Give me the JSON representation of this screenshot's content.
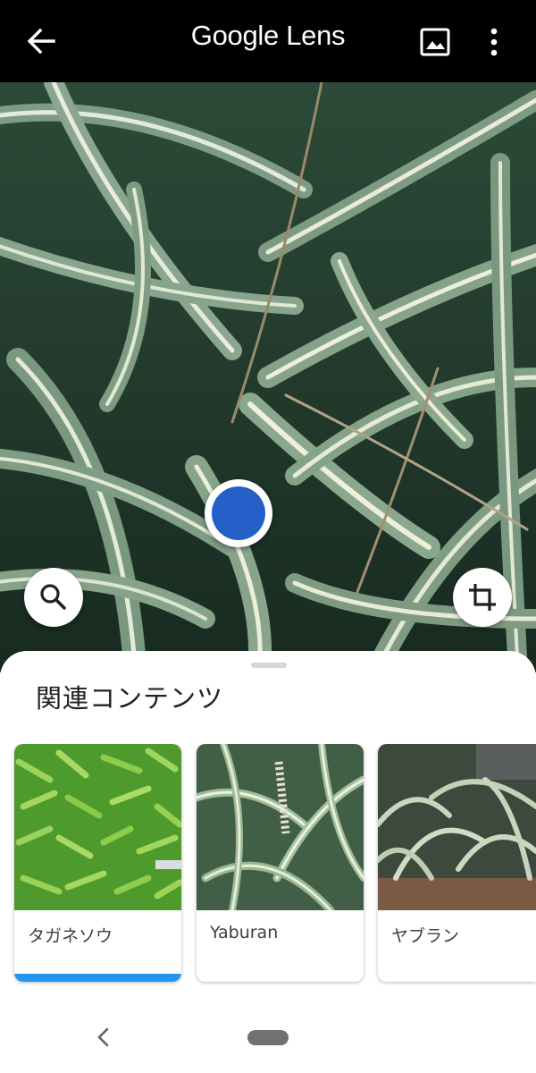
{
  "app": {
    "title": "Google Lens"
  },
  "toolbar": {
    "back_icon": "arrow-back-icon",
    "gallery_icon": "image-gallery-icon",
    "more_icon": "more-vert-icon"
  },
  "viewer": {
    "search_icon": "search-icon",
    "crop_icon": "crop-icon",
    "accent_color": "#2460c8"
  },
  "related": {
    "heading": "関連コンテンツ",
    "cards": [
      {
        "label": "タガネソウ",
        "selected": true
      },
      {
        "label": "Yaburan",
        "selected": false
      },
      {
        "label": "ヤブラン",
        "selected": false
      }
    ],
    "selected_bar_color": "#2196f3"
  },
  "navigation": {
    "back_icon": "nav-back-icon",
    "home_icon": "home-pill-icon"
  }
}
